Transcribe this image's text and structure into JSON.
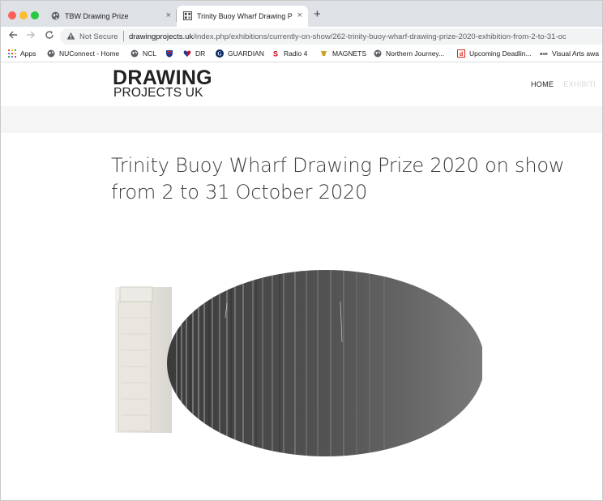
{
  "browser": {
    "tabs": [
      {
        "title": "TBW Drawing Prize",
        "active": false
      },
      {
        "title": "Trinity Buoy Wharf Drawing Pri",
        "active": true
      }
    ],
    "new_tab": "+",
    "close_glyph": "×",
    "security": "Not Secure",
    "url_domain": "drawingprojects.uk",
    "url_path": "/index.php/exhibitions/currently-on-show/262-trinity-buoy-wharf-drawing-prize-2020-exhibition-from-2-to-31-oc",
    "bookmarks": [
      {
        "label": "Apps",
        "icon": "apps-grid-icon"
      },
      {
        "label": "NUConnect - Home",
        "icon": "globe-icon"
      },
      {
        "label": "NCL",
        "icon": "globe-icon"
      },
      {
        "label": "",
        "icon": "shield-crest-icon"
      },
      {
        "label": "DR",
        "icon": "heart-icon"
      },
      {
        "label": "GUARDIAN",
        "icon": "guardian-icon"
      },
      {
        "label": "Radio 4",
        "icon": "radio-icon"
      },
      {
        "label": "MAGNETS",
        "icon": "magnet-icon"
      },
      {
        "label": "Northern Journey...",
        "icon": "globe-icon"
      },
      {
        "label": "Upcoming Deadlin...",
        "icon": "document-icon"
      },
      {
        "label": "Visual Arts awa",
        "icon": "bsr-icon"
      }
    ]
  },
  "site": {
    "logo_line1": "DRAWING",
    "logo_line2": "PROJECTS UK",
    "nav": {
      "home": "HOME",
      "exhibitions": "EXHIBITI"
    }
  },
  "article": {
    "title": "Trinity Buoy Wharf Drawing Prize 2020 on show from 2 to 31 October 2020"
  },
  "colors": {
    "tabstrip": "#dee1e6",
    "page_band": "#f5f5f5",
    "headline": "#3a3a3a"
  }
}
